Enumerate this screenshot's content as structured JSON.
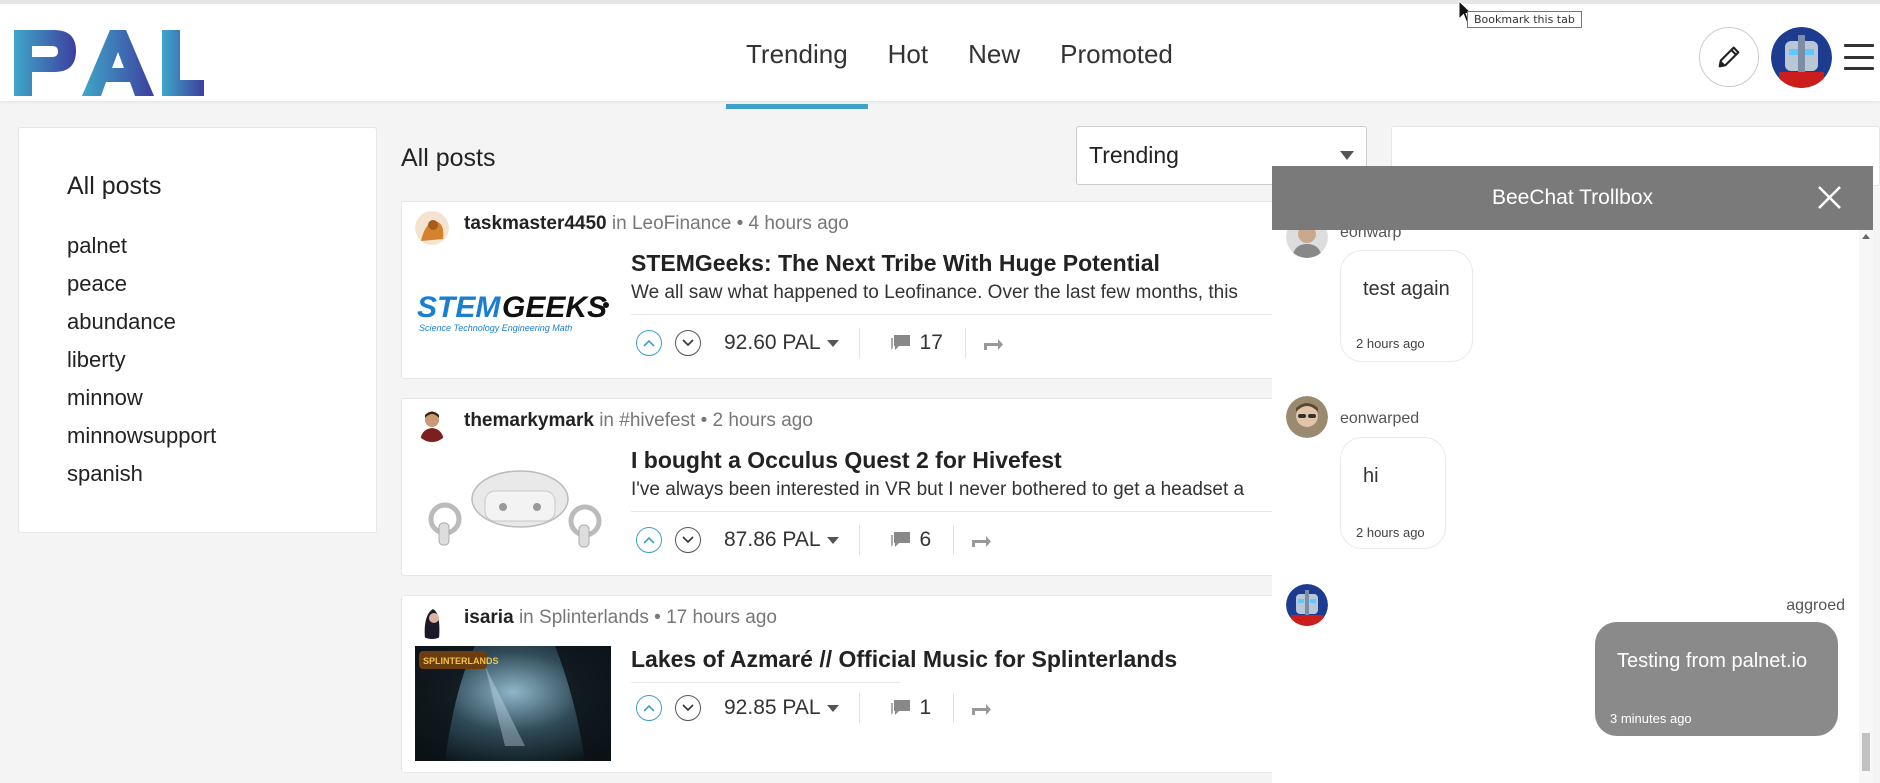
{
  "header": {
    "logo_text": "PAL",
    "nav": [
      {
        "label": "Trending",
        "active": true
      },
      {
        "label": "Hot",
        "active": false
      },
      {
        "label": "New",
        "active": false
      },
      {
        "label": "Promoted",
        "active": false
      }
    ],
    "tooltip": "Bookmark this tab"
  },
  "sidebar": {
    "title": "All posts",
    "items": [
      "palnet",
      "peace",
      "abundance",
      "liberty",
      "minnow",
      "minnowsupport",
      "spanish"
    ]
  },
  "feed": {
    "title": "All posts",
    "sort_selected": "Trending",
    "posts": [
      {
        "author": "taskmaster4450",
        "in_label": "in",
        "community": "LeoFinance",
        "time": "• 4 hours ago",
        "title": "STEMGeeks: The Next Tribe With Huge Potential",
        "excerpt": "We all saw what happened to Leofinance. Over the last few months, this",
        "amount": "92.60 PAL",
        "comments": "17",
        "thumb_text_1": "STEMGEEKS",
        "thumb_text_2": "Science Technology Engineering Math"
      },
      {
        "author": "themarkymark",
        "in_label": "in",
        "community": "#hivefest",
        "time": "• 2 hours ago",
        "title": "I bought a Occulus Quest 2 for Hivefest",
        "excerpt": "I've always been interested in VR but I never bothered to get a headset a",
        "amount": "87.86 PAL",
        "comments": "6"
      },
      {
        "author": "isaria",
        "in_label": "in",
        "community": "Splinterlands",
        "time": "• 17 hours ago",
        "title": "Lakes of Azmaré // Official Music for Splinterlands",
        "excerpt": "",
        "amount": "92.85 PAL",
        "comments": "1",
        "thumb_text_1": "SPLINTERLANDS"
      }
    ]
  },
  "chat": {
    "title": "BeeChat Trollbox",
    "messages": [
      {
        "user": "eonwarp",
        "text": "test again",
        "time": "2 hours ago",
        "mine": false
      },
      {
        "user": "eonwarped",
        "text": "hi",
        "time": "2 hours ago",
        "mine": false
      },
      {
        "user": "aggroed",
        "text": "Testing from palnet.io",
        "time": "3 minutes ago",
        "mine": true
      }
    ]
  },
  "colors": {
    "accent": "#3fa0c9",
    "logo_gradient_start": "#3fa7c9",
    "logo_gradient_end": "#3c3f9e",
    "chat_header": "#7a7a7a",
    "my_bubble": "#8a8a8a"
  }
}
